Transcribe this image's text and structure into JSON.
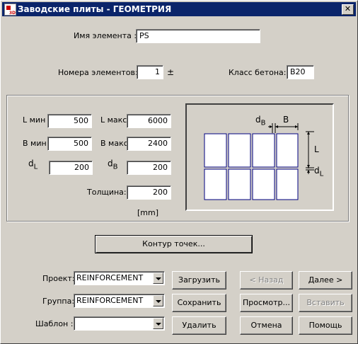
{
  "window": {
    "title": "Заводские плиты - ГЕОМЕТРИЯ",
    "close_symbol": "✕"
  },
  "element": {
    "name_label": "Имя элемента :",
    "name_value": "PS"
  },
  "numbers": {
    "label": "Номера элементов:",
    "value": "1",
    "suffix": "±"
  },
  "concrete": {
    "label": "Класс бетона:",
    "value": "B20"
  },
  "geometry": {
    "l_min_label": "L мин",
    "l_min": "500",
    "l_max_label": "L макс",
    "l_max": "6000",
    "b_min_label": "B мин",
    "b_min": "500",
    "b_max_label": "B макс",
    "b_max": "2400",
    "dl_main": "d",
    "dl_sub": "L",
    "dl_value": "200",
    "db_main": "d",
    "db_sub": "B",
    "db_value": "200",
    "thickness_label": "Толщина:",
    "thickness": "200",
    "unit": "[mm]"
  },
  "diagram_labels": {
    "db_main": "d",
    "db_sub": "B",
    "b": "B",
    "l": "L",
    "dl_main": "d",
    "dl_sub": "L"
  },
  "contour_button": "Контур точек...",
  "project": {
    "label": "Проект:",
    "value": "REINFORCEMENT"
  },
  "group": {
    "label": "Группа:",
    "value": "REINFORCEMENT"
  },
  "template": {
    "label": "Шаблон :",
    "value": ""
  },
  "buttons": {
    "load": "Загрузить",
    "save": "Сохранить",
    "delete": "Удалить",
    "back": "< Назад",
    "next": "Далее >",
    "preview": "Просмотр...",
    "insert": "Вставить",
    "cancel": "Отмена",
    "help": "Помощь"
  },
  "colors": {
    "title_bg": "#0a246a",
    "face": "#d4d0c8",
    "diagram_line": "#000080"
  }
}
